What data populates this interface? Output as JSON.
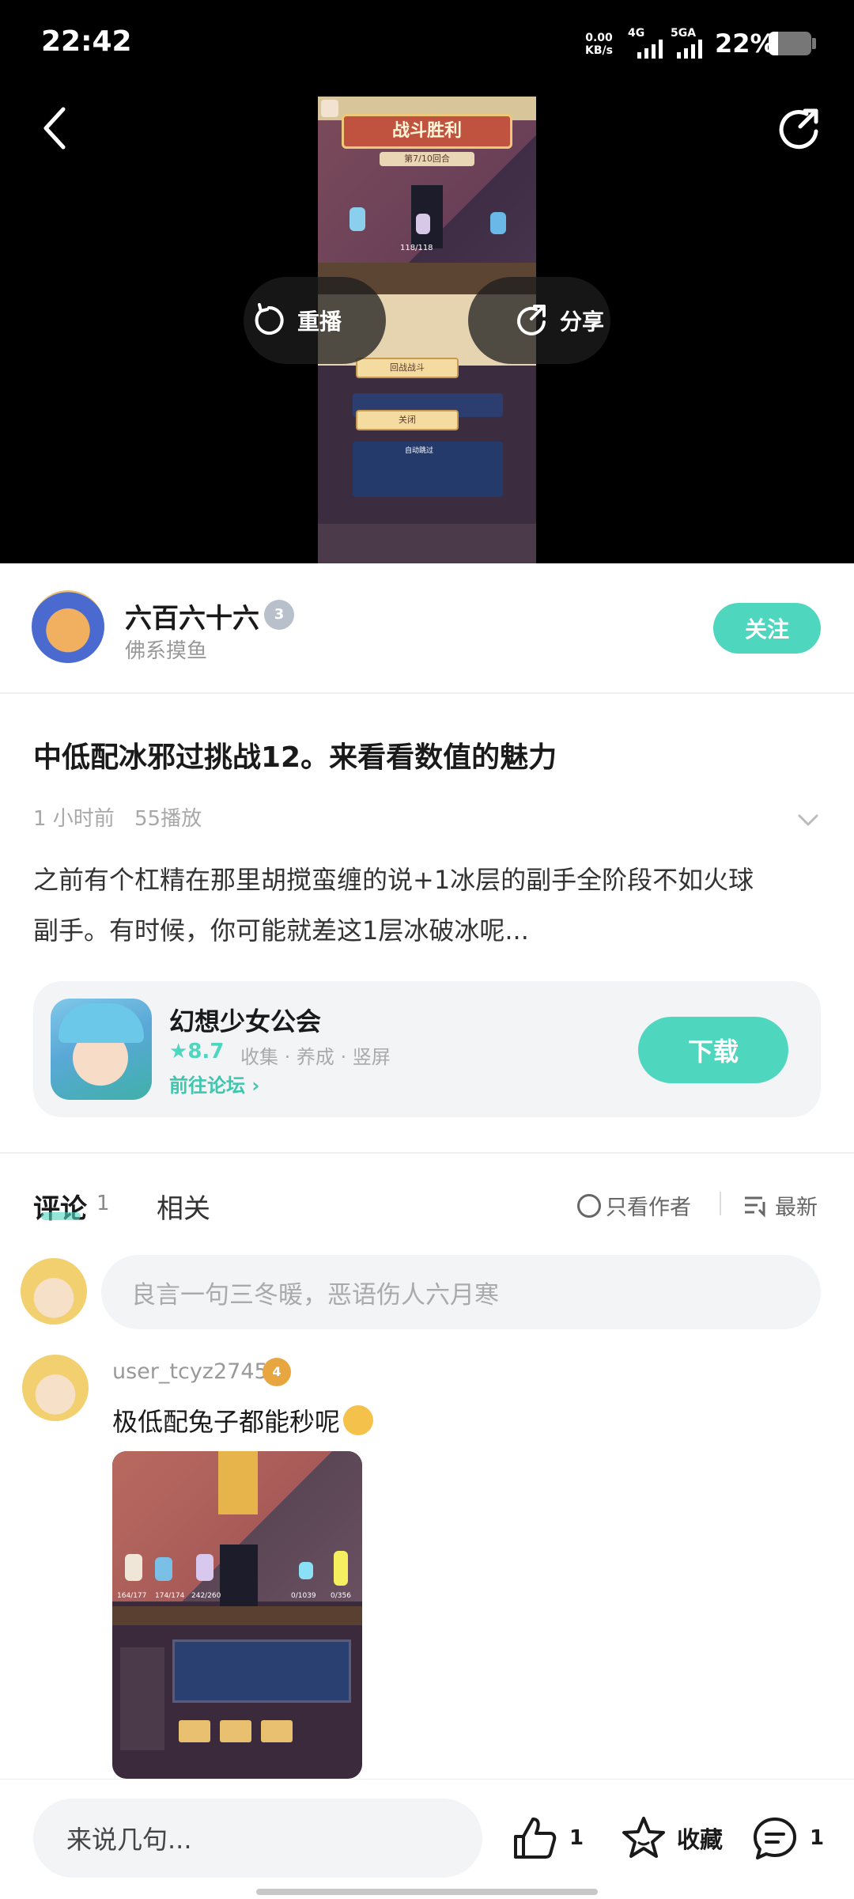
{
  "status_bar": {
    "time": "22:42",
    "net_speed_value": "0.00",
    "net_speed_unit": "KB/s",
    "sig1": "4G",
    "sig2": "5GA",
    "battery": "22%",
    "battery_level": 0.22
  },
  "video": {
    "replay_label": "重播",
    "share_label": "分享",
    "game": {
      "victory": "战斗胜利",
      "round": "第7/10回合",
      "hp_mid": "118/118",
      "return_battle": "回战战斗",
      "close": "关闭",
      "auto_skip": "自动跳过"
    }
  },
  "author": {
    "name": "六百六十六",
    "level_badge": "3",
    "subtitle": "佛系摸鱼",
    "follow_label": "关注"
  },
  "post": {
    "title": "中低配冰邪过挑战12。来看看数值的魅力",
    "time": "1 小时前",
    "plays": "55播放",
    "body_line1": "之前有个杠精在那里胡搅蛮缠的说+1冰层的副手全阶段不如火球",
    "body_line2": "副手。有时候，你可能就差这1层冰破冰呢..."
  },
  "app_card": {
    "name": "幻想少女公会",
    "rating": "8.7",
    "tags": "收集 · 养成 · 竖屏",
    "forum_link": "前往论坛",
    "download_label": "下载"
  },
  "tabs": {
    "comments_label": "评论",
    "comments_count": "1",
    "related_label": "相关",
    "author_only": "只看作者",
    "sort_latest": "最新"
  },
  "comment_input": {
    "placeholder": "良言一句三冬暖，恶语伤人六月寒"
  },
  "comment": {
    "username": "user_tcyz2745",
    "level_badge": "4",
    "text": "极低配兔子都能秒呢",
    "image": {
      "hp1": "164/177",
      "hp2": "174/174",
      "hp3": "242/260",
      "hp4": "0/1039",
      "hp5": "0/356"
    }
  },
  "bottom_bar": {
    "input_placeholder": "来说几句...",
    "like_count": "1",
    "favorite_label": "收藏",
    "comment_count": "1"
  },
  "colors": {
    "accent": "#4fd6bf",
    "text_primary": "#1a1a1a",
    "text_secondary": "#999999"
  }
}
